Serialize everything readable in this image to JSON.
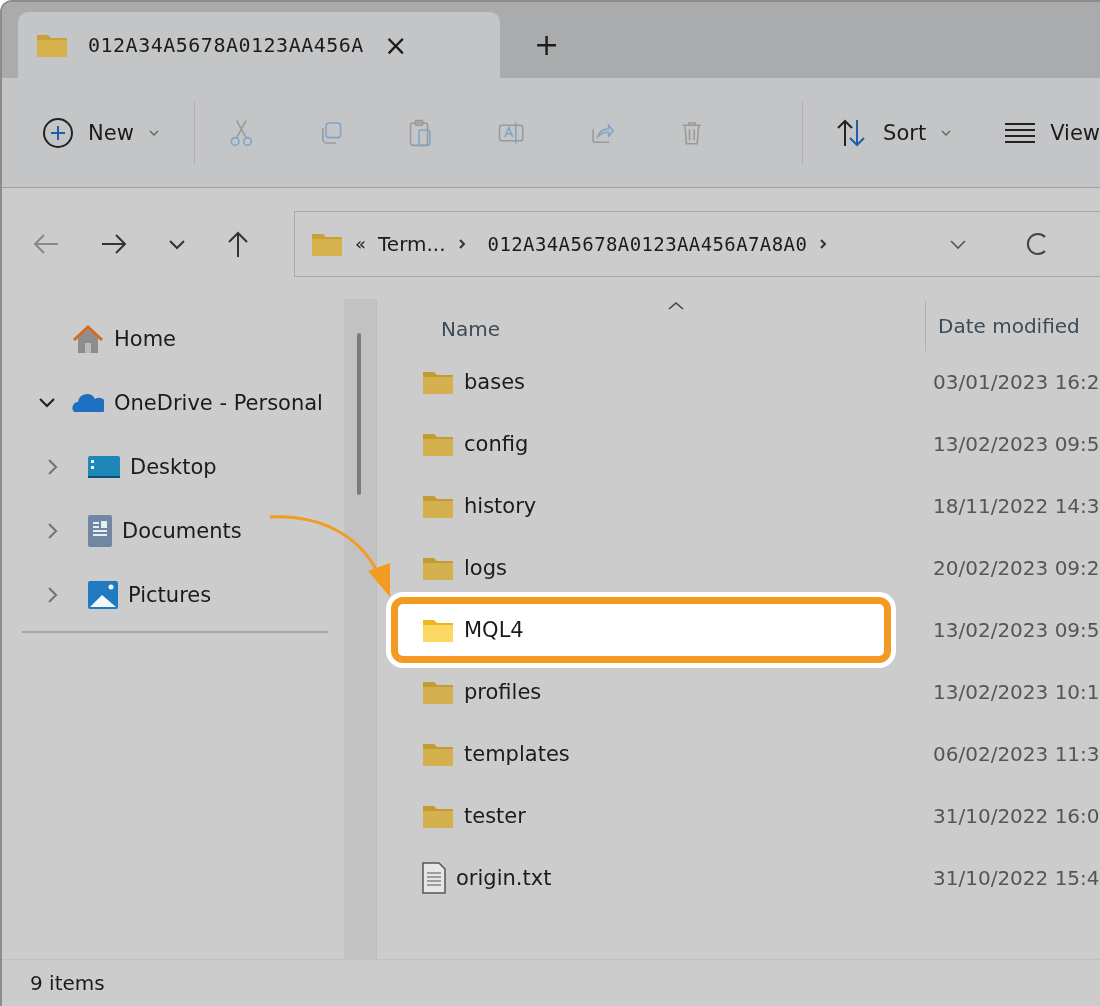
{
  "tab": {
    "title": "012A34A5678A0123AA456A",
    "close": "×",
    "add": "+"
  },
  "toolbar": {
    "new": "New",
    "sort": "Sort",
    "view": "View"
  },
  "address": {
    "collapse": "«",
    "parent": "Term...",
    "path": "012A34A5678A0123AA456A7A8A0"
  },
  "sidebar": {
    "items": [
      {
        "label": "Home",
        "kind": "home"
      },
      {
        "label": "OneDrive - Personal",
        "kind": "cloud",
        "expanded": true,
        "children": [
          {
            "label": "Desktop",
            "kind": "desktop",
            "expanded": false
          },
          {
            "label": "Documents",
            "kind": "documents",
            "expanded": false
          },
          {
            "label": "Pictures",
            "kind": "pictures",
            "expanded": false
          }
        ]
      }
    ]
  },
  "table": {
    "columns": [
      "Name",
      "Date modified"
    ],
    "rows": [
      {
        "name": "bases",
        "date": "03/01/2023 16:2",
        "kind": "folder",
        "highlighted": false
      },
      {
        "name": "config",
        "date": "13/02/2023 09:5",
        "kind": "folder",
        "highlighted": false
      },
      {
        "name": "history",
        "date": "18/11/2022 14:3",
        "kind": "folder",
        "highlighted": false
      },
      {
        "name": "logs",
        "date": "20/02/2023 09:2",
        "kind": "folder",
        "highlighted": false
      },
      {
        "name": "MQL4",
        "date": "13/02/2023 09:5",
        "kind": "folder",
        "highlighted": true
      },
      {
        "name": "profiles",
        "date": "13/02/2023 10:1",
        "kind": "folder",
        "highlighted": false
      },
      {
        "name": "templates",
        "date": "06/02/2023 11:3",
        "kind": "folder",
        "highlighted": false
      },
      {
        "name": "tester",
        "date": "31/10/2022 16:0",
        "kind": "folder",
        "highlighted": false
      },
      {
        "name": "origin.txt",
        "date": "31/10/2022 15:4",
        "kind": "file",
        "highlighted": false
      }
    ]
  },
  "status_bar": {
    "count": "9 items"
  }
}
